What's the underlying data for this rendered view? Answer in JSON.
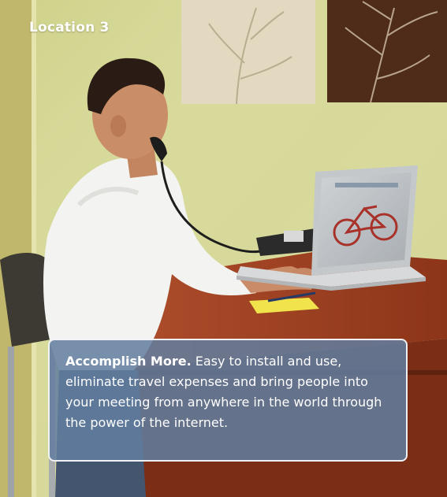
{
  "location_label": "Location 3",
  "caption": {
    "lead": "Accomplish More.",
    "body": " Easy to install and use, eliminate travel expenses and bring people into your meeting from anywhere in the world through the power of the internet."
  },
  "colors": {
    "wall": "#d9dc9a",
    "desk": "#9b3d22",
    "caption_bg": "#627e9e",
    "brown_panel": "#4f2c19",
    "shirt": "#f4f5f2"
  }
}
